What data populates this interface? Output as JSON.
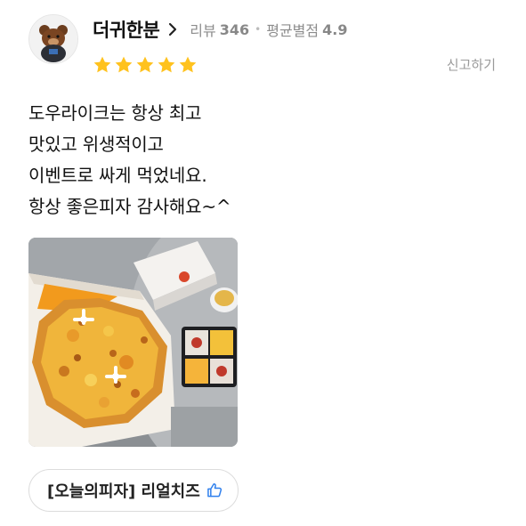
{
  "review": {
    "nickname": "더귀한분",
    "review_label": "리뷰",
    "review_count": "346",
    "avg_label": "평균별점",
    "avg_rating": "4.9",
    "rating": 5,
    "report_label": "신고하기",
    "text_lines": [
      "도우라이크는 항상 최고",
      "맛있고 위생적이고",
      "이벤트로 싸게 먹었네요.",
      "항상 좋은피자 감사해요~^"
    ],
    "menu_tag": "[오늘의피자] 리얼치즈"
  },
  "colors": {
    "star": "#FFC21E",
    "like_icon": "#2F80ED"
  },
  "icons": {
    "avatar": "teddy-bear-avatar",
    "chevron": "chevron-right-icon",
    "star": "star-icon",
    "like": "thumbs-up-icon"
  }
}
